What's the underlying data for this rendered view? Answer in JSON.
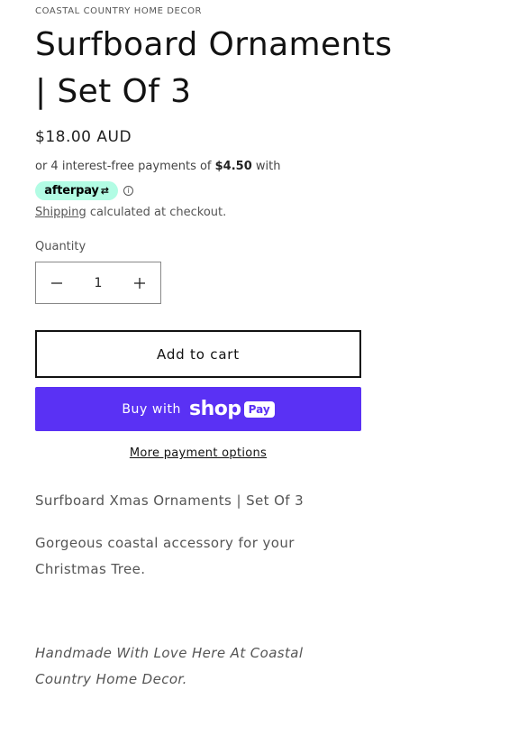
{
  "product": {
    "vendor": "COASTAL COUNTRY HOME DECOR",
    "title": "Surfboard Ornaments | Set Of 3",
    "price": "$18.00 AUD"
  },
  "afterpay": {
    "prefix": "or 4 interest-free payments of ",
    "amount": "$4.50",
    "suffix": " with",
    "badge_label": "afterpay",
    "info_symbol": "i"
  },
  "shipping": {
    "link_label": "Shipping",
    "rest": " calculated at checkout."
  },
  "quantity": {
    "label": "Quantity",
    "value": "1",
    "decrement_symbol": "−",
    "increment_symbol": "+"
  },
  "buttons": {
    "add_to_cart": "Add to cart",
    "buy_with": "Buy with",
    "shop_word": "shop",
    "pay_word": "Pay",
    "more_payment": "More payment options"
  },
  "description": {
    "line1": "Surfboard Xmas Ornaments | Set Of 3",
    "line2": "Gorgeous coastal accessory for your Christmas Tree.",
    "line3": "Handmade With Love Here At Coastal Country Home Decor."
  },
  "colors": {
    "shop_pay": "#5a31f4",
    "afterpay_mint": "#b2fce4"
  }
}
